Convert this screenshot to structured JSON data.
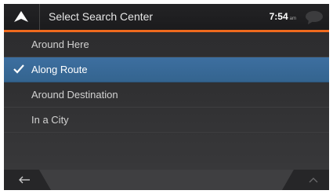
{
  "header": {
    "title": "Select Search Center",
    "time": "7:54",
    "ampm": "am",
    "icons": [
      "navigate-up-arrow-icon",
      "message-bubble-icon"
    ]
  },
  "colors": {
    "accent": "#ef6a1e",
    "selected": "#3d6fa0"
  },
  "options": {
    "items": [
      {
        "label": "Around Here",
        "selected": false
      },
      {
        "label": "Along Route",
        "selected": true
      },
      {
        "label": "Around Destination",
        "selected": false
      },
      {
        "label": "In a City",
        "selected": false
      }
    ]
  },
  "footer": {
    "icons": [
      "back-arrow-icon",
      "scroll-up-icon"
    ]
  }
}
